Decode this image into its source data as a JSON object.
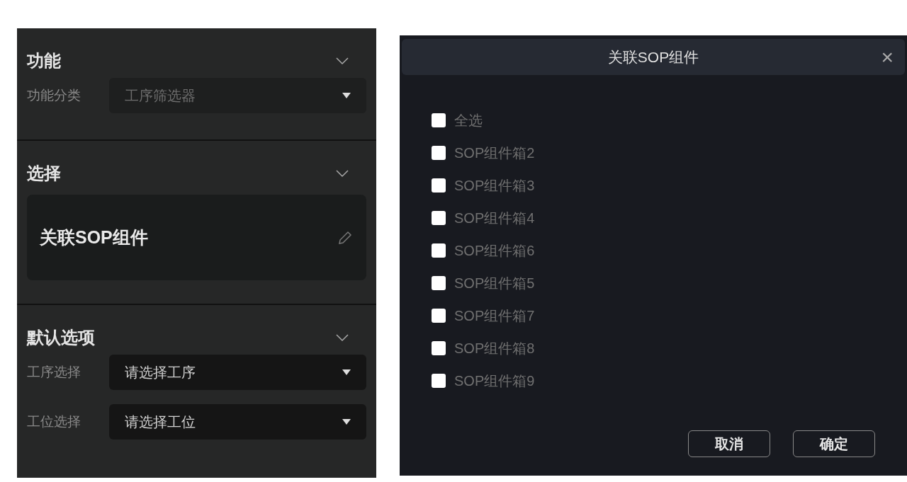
{
  "panel": {
    "sections": [
      {
        "kind": "fields",
        "title": "功能",
        "expanded": true,
        "fields": [
          {
            "label": "功能分类",
            "value": "工序筛选器",
            "disabled": true
          }
        ]
      },
      {
        "kind": "card",
        "title": "选择",
        "expanded": true,
        "card_text": "关联SOP组件"
      },
      {
        "kind": "fields",
        "title": "默认选项",
        "expanded": true,
        "fields": [
          {
            "label": "工序选择",
            "placeholder": "请选择工序",
            "disabled": false
          },
          {
            "label": "工位选择",
            "placeholder": "请选择工位",
            "disabled": false
          }
        ]
      }
    ]
  },
  "dialog": {
    "title": "关联SOP组件",
    "close": "×",
    "items": [
      {
        "label": "全选",
        "checked": false
      },
      {
        "label": "SOP组件箱2",
        "checked": false
      },
      {
        "label": "SOP组件箱3",
        "checked": false
      },
      {
        "label": "SOP组件箱4",
        "checked": false
      },
      {
        "label": "SOP组件箱6",
        "checked": false
      },
      {
        "label": "SOP组件箱5",
        "checked": false
      },
      {
        "label": "SOP组件箱7",
        "checked": false
      },
      {
        "label": "SOP组件箱8",
        "checked": false
      },
      {
        "label": "SOP组件箱9",
        "checked": false
      }
    ],
    "buttons": [
      "取消",
      "确定"
    ]
  }
}
